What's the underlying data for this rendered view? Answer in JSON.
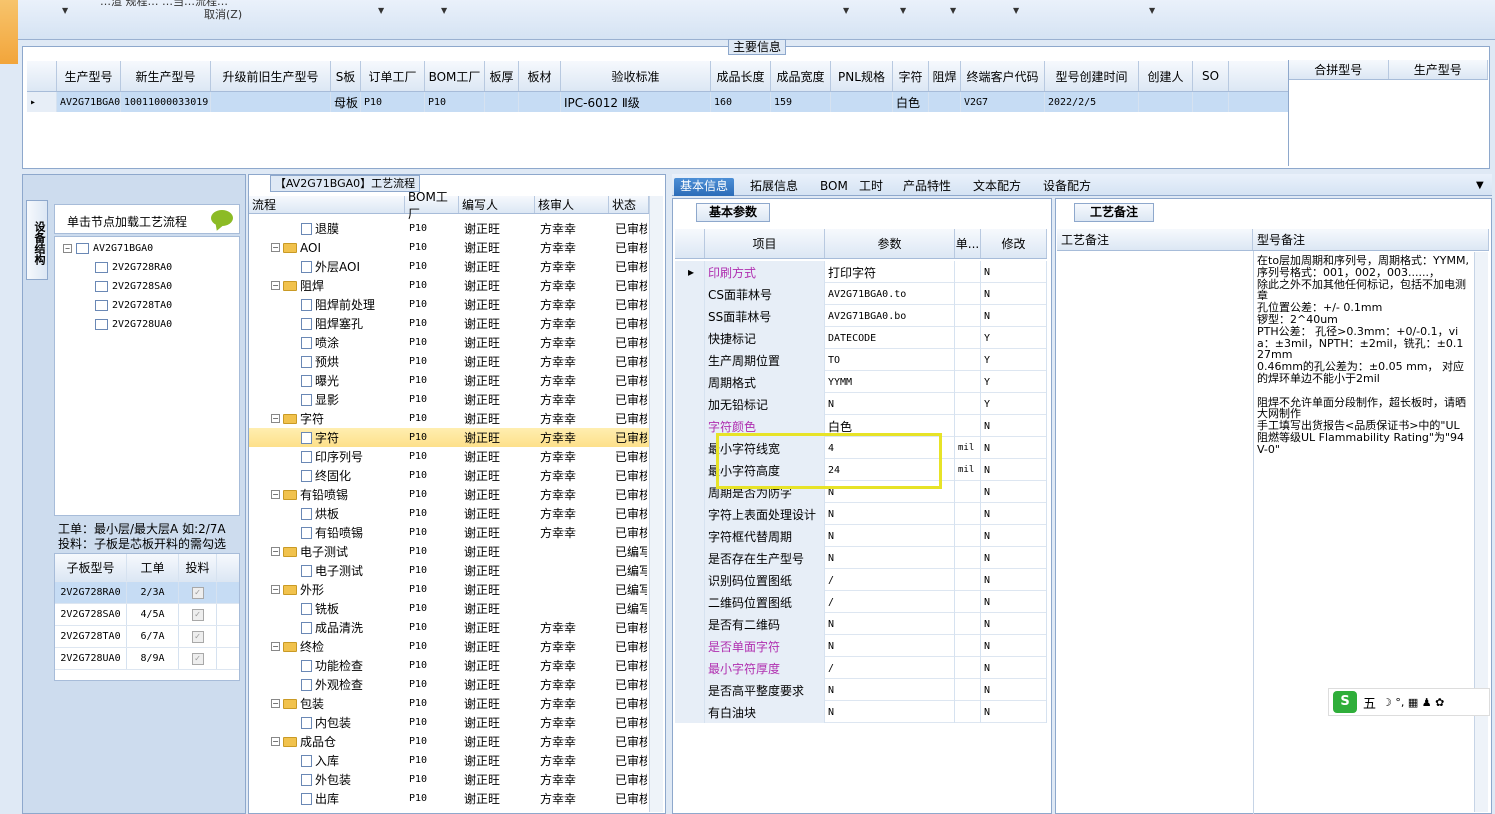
{
  "toolbar": {
    "top_text": "…渲 规程…  …当…流程…",
    "cancel_label": "取消(Z)"
  },
  "main_info": {
    "title": "主要信息",
    "columns": [
      "生产型号",
      "新生产型号",
      "升级前旧生产型号",
      "S板",
      "订单工厂",
      "BOM工厂",
      "板厚",
      "板材",
      "验收标准",
      "成品长度",
      "成品宽度",
      "PNL规格",
      "字符",
      "阻焊",
      "终端客户代码",
      "型号创建时间",
      "创建人",
      "SO"
    ],
    "row": [
      "AV2G71BGA0",
      "10011000033019",
      "",
      "母板",
      "P10",
      "P10",
      "",
      "",
      "IPC-6012 Ⅱ级",
      "160",
      "159",
      "",
      "白色",
      "",
      "V2G7",
      "2022/2/5",
      "",
      ""
    ],
    "merge_columns": [
      "合拼型号",
      "生产型号"
    ]
  },
  "left": {
    "vtab_label": "设备结构",
    "load_flow_label": "单击节点加载工艺流程",
    "tree": {
      "root": "AV2G71BGA0",
      "children": [
        "2V2G728RA0",
        "2V2G728SA0",
        "2V2G728TA0",
        "2V2G728UA0"
      ]
    },
    "info_line1": "工单：最小层/最大层A 如:2/7A",
    "info_line2": "投料：子板是芯板开料的需勾选",
    "sub_table": {
      "columns": [
        "子板型号",
        "工单",
        "投料"
      ],
      "rows": [
        {
          "model": "2V2G728RA0",
          "order": "2/3A"
        },
        {
          "model": "2V2G728SA0",
          "order": "4/5A"
        },
        {
          "model": "2V2G728TA0",
          "order": "6/7A"
        },
        {
          "model": "2V2G728UA0",
          "order": "8/9A"
        }
      ],
      "check_mark": "✓"
    }
  },
  "process": {
    "title": "【AV2G71BGA0】工艺流程",
    "columns": [
      "流程",
      "BOM工厂",
      "编写人",
      "核审人",
      "状态"
    ],
    "rows": [
      {
        "name": "退膜",
        "level": 2,
        "bom": "P10",
        "writer": "谢正旺",
        "reviewer": "方幸幸",
        "status": "已审核"
      },
      {
        "name": "AOI",
        "level": 1,
        "bom": "P10",
        "writer": "谢正旺",
        "reviewer": "方幸幸",
        "status": "已审核"
      },
      {
        "name": "外层AOI",
        "level": 2,
        "bom": "P10",
        "writer": "谢正旺",
        "reviewer": "方幸幸",
        "status": "已审核"
      },
      {
        "name": "阻焊",
        "level": 1,
        "bom": "P10",
        "writer": "谢正旺",
        "reviewer": "方幸幸",
        "status": "已审核"
      },
      {
        "name": "阻焊前处理",
        "level": 2,
        "bom": "P10",
        "writer": "谢正旺",
        "reviewer": "方幸幸",
        "status": "已审核"
      },
      {
        "name": "阻焊塞孔",
        "level": 2,
        "bom": "P10",
        "writer": "谢正旺",
        "reviewer": "方幸幸",
        "status": "已审核"
      },
      {
        "name": "喷涂",
        "level": 2,
        "bom": "P10",
        "writer": "谢正旺",
        "reviewer": "方幸幸",
        "status": "已审核"
      },
      {
        "name": "预烘",
        "level": 2,
        "bom": "P10",
        "writer": "谢正旺",
        "reviewer": "方幸幸",
        "status": "已审核"
      },
      {
        "name": "曝光",
        "level": 2,
        "bom": "P10",
        "writer": "谢正旺",
        "reviewer": "方幸幸",
        "status": "已审核"
      },
      {
        "name": "显影",
        "level": 2,
        "bom": "P10",
        "writer": "谢正旺",
        "reviewer": "方幸幸",
        "status": "已审核"
      },
      {
        "name": "字符",
        "level": 1,
        "bom": "P10",
        "writer": "谢正旺",
        "reviewer": "方幸幸",
        "status": "已审核"
      },
      {
        "name": "字符",
        "level": 2,
        "bom": "P10",
        "writer": "谢正旺",
        "reviewer": "方幸幸",
        "status": "已审核",
        "selected": true
      },
      {
        "name": "印序列号",
        "level": 2,
        "bom": "P10",
        "writer": "谢正旺",
        "reviewer": "方幸幸",
        "status": "已审核"
      },
      {
        "name": "终固化",
        "level": 2,
        "bom": "P10",
        "writer": "谢正旺",
        "reviewer": "方幸幸",
        "status": "已审核"
      },
      {
        "name": "有铅喷锡",
        "level": 1,
        "bom": "P10",
        "writer": "谢正旺",
        "reviewer": "方幸幸",
        "status": "已审核"
      },
      {
        "name": "烘板",
        "level": 2,
        "bom": "P10",
        "writer": "谢正旺",
        "reviewer": "方幸幸",
        "status": "已审核"
      },
      {
        "name": "有铅喷锡",
        "level": 2,
        "bom": "P10",
        "writer": "谢正旺",
        "reviewer": "方幸幸",
        "status": "已审核"
      },
      {
        "name": "电子测试",
        "level": 1,
        "bom": "P10",
        "writer": "谢正旺",
        "reviewer": "",
        "status": "已编写"
      },
      {
        "name": "电子测试",
        "level": 2,
        "bom": "P10",
        "writer": "谢正旺",
        "reviewer": "",
        "status": "已编写"
      },
      {
        "name": "外形",
        "level": 1,
        "bom": "P10",
        "writer": "谢正旺",
        "reviewer": "",
        "status": "已编写"
      },
      {
        "name": "铣板",
        "level": 2,
        "bom": "P10",
        "writer": "谢正旺",
        "reviewer": "",
        "status": "已编写"
      },
      {
        "name": "成品清洗",
        "level": 2,
        "bom": "P10",
        "writer": "谢正旺",
        "reviewer": "方幸幸",
        "status": "已审核"
      },
      {
        "name": "终检",
        "level": 1,
        "bom": "P10",
        "writer": "谢正旺",
        "reviewer": "方幸幸",
        "status": "已审核"
      },
      {
        "name": "功能检查",
        "level": 2,
        "bom": "P10",
        "writer": "谢正旺",
        "reviewer": "方幸幸",
        "status": "已审核"
      },
      {
        "name": "外观检查",
        "level": 2,
        "bom": "P10",
        "writer": "谢正旺",
        "reviewer": "方幸幸",
        "status": "已审核"
      },
      {
        "name": "包装",
        "level": 1,
        "bom": "P10",
        "writer": "谢正旺",
        "reviewer": "方幸幸",
        "status": "已审核"
      },
      {
        "name": "内包装",
        "level": 2,
        "bom": "P10",
        "writer": "谢正旺",
        "reviewer": "方幸幸",
        "status": "已审核"
      },
      {
        "name": "成品仓",
        "level": 1,
        "bom": "P10",
        "writer": "谢正旺",
        "reviewer": "方幸幸",
        "status": "已审核"
      },
      {
        "name": "入库",
        "level": 2,
        "bom": "P10",
        "writer": "谢正旺",
        "reviewer": "方幸幸",
        "status": "已审核"
      },
      {
        "name": "外包装",
        "level": 2,
        "bom": "P10",
        "writer": "谢正旺",
        "reviewer": "方幸幸",
        "status": "已审核"
      },
      {
        "name": "出库",
        "level": 2,
        "bom": "P10",
        "writer": "谢正旺",
        "reviewer": "方幸幸",
        "status": "已审核"
      }
    ]
  },
  "tabs": [
    "基本信息",
    "拓展信息",
    "BOM",
    "工时",
    "产品特性",
    "文本配方",
    "设备配方"
  ],
  "basic": {
    "tab_label": "基本参数",
    "columns": [
      "项目",
      "参数",
      "单...",
      "修改"
    ],
    "rows": [
      {
        "item": "印刷方式",
        "param": "打印字符",
        "unit": "",
        "mod": "N",
        "purple": true,
        "current": true
      },
      {
        "item": "CS面菲林号",
        "param": "AV2G71BGA0.to",
        "unit": "",
        "mod": "N"
      },
      {
        "item": "SS面菲林号",
        "param": "AV2G71BGA0.bo",
        "unit": "",
        "mod": "N"
      },
      {
        "item": "快捷标记",
        "param": "DATECODE",
        "unit": "",
        "mod": "Y"
      },
      {
        "item": "生产周期位置",
        "param": "TO",
        "unit": "",
        "mod": "Y"
      },
      {
        "item": "周期格式",
        "param": "YYMM",
        "unit": "",
        "mod": "Y"
      },
      {
        "item": "加无铅标记",
        "param": "N",
        "unit": "",
        "mod": "Y"
      },
      {
        "item": "字符颜色",
        "param": "白色",
        "unit": "",
        "mod": "N",
        "purple": true
      },
      {
        "item": "最小字符线宽",
        "param": "4",
        "unit": "mil",
        "mod": "N"
      },
      {
        "item": "最小字符高度",
        "param": "24",
        "unit": "mil",
        "mod": "N"
      },
      {
        "item": "周期是否为防字",
        "param": "N",
        "unit": "",
        "mod": "N"
      },
      {
        "item": "字符上表面处理设计",
        "param": "N",
        "unit": "",
        "mod": "N"
      },
      {
        "item": "字符框代替周期",
        "param": "N",
        "unit": "",
        "mod": "N"
      },
      {
        "item": "是否存在生产型号",
        "param": "N",
        "unit": "",
        "mod": "N"
      },
      {
        "item": "识别码位置图纸",
        "param": "/",
        "unit": "",
        "mod": "N"
      },
      {
        "item": "二维码位置图纸",
        "param": "/",
        "unit": "",
        "mod": "N"
      },
      {
        "item": "是否有二维码",
        "param": "N",
        "unit": "",
        "mod": "N"
      },
      {
        "item": "是否单面字符",
        "param": "N",
        "unit": "",
        "mod": "N",
        "purple": true
      },
      {
        "item": "最小字符厚度",
        "param": "/",
        "unit": "",
        "mod": "N",
        "purple": true
      },
      {
        "item": "是否高平整度要求",
        "param": "N",
        "unit": "",
        "mod": "N"
      },
      {
        "item": "有白油块",
        "param": "N",
        "unit": "",
        "mod": "N"
      }
    ]
  },
  "remarks": {
    "tab_label": "工艺备注",
    "columns": [
      "工艺备注",
      "型号备注"
    ],
    "model_note": "在to层加周期和序列号，周期格式：YYMM,序列号格式：001，002，003......，\n除此之外不加其他任何标记，包括不加电测章\n孔位置公差：+/- 0.1mm\n锣型：2^40um\nPTH公差： 孔径>0.3mm：+0/-0.1，via：±3mil，NPTH：±2mil，铣孔：±0.127mm\n0.46mm的孔公差为：±0.05 mm， 对应的焊环单边不能小于2mil\n\n阻焊不允许单面分段制作，超长板时，请晒大网制作\n手工填写出货报告<品质保证书>中的\"UL阻燃等级UL Flammability Rating\"为\"94V-0\""
  },
  "ime": {
    "logo": "S",
    "label": "五",
    "icons": "☽ °, ▦ ♟ ✿"
  }
}
